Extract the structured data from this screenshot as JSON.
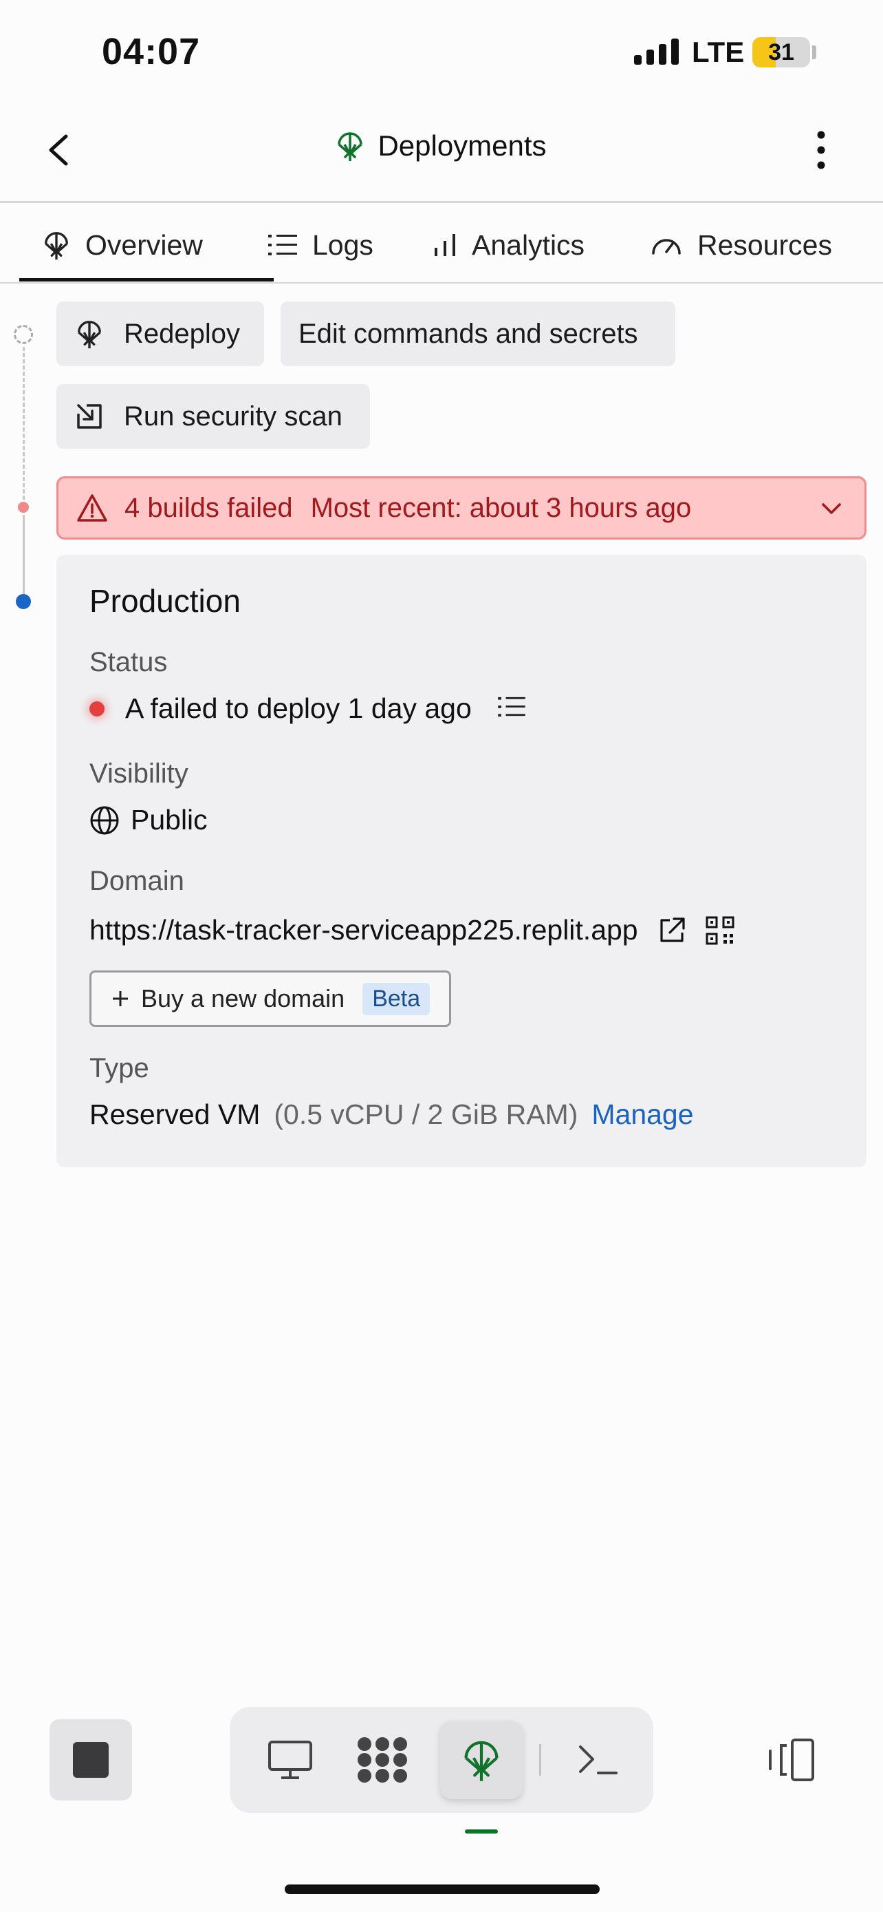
{
  "status_bar": {
    "time": "04:07",
    "network": "LTE",
    "battery": "31",
    "battery_level": 0.31,
    "battery_color": "#f5c518"
  },
  "header": {
    "back_icon": "chevron-left-icon",
    "title_icon": "deployments-icon",
    "title": "Deployments",
    "more_icon": "more-vertical-icon"
  },
  "tabs": [
    {
      "label": "Overview",
      "icon": "deployments-icon",
      "active": true
    },
    {
      "label": "Logs",
      "icon": "list-icon",
      "active": false
    },
    {
      "label": "Analytics",
      "icon": "bar-chart-icon",
      "active": false
    },
    {
      "label": "Resources",
      "icon": "gauge-icon",
      "active": false
    }
  ],
  "actions": {
    "redeploy": "Redeploy",
    "edit": "Edit commands and secrets",
    "scan": "Run security scan"
  },
  "alert": {
    "title": "4 builds failed",
    "subtitle": "Most recent: about 3 hours ago",
    "color": "#a1191d"
  },
  "production": {
    "title": "Production",
    "status_label": "Status",
    "status_value": "A failed to deploy 1 day ago",
    "visibility_label": "Visibility",
    "visibility_value": "Public",
    "domain_label": "Domain",
    "domain_value": "https://task-tracker-serviceapp225.replit.app",
    "buy_domain": "Buy a new domain",
    "beta_badge": "Beta",
    "type_label": "Type",
    "type_value": "Reserved VM",
    "type_spec": "(0.5 vCPU / 2 GiB RAM)",
    "manage": "Manage"
  },
  "bottom_bar": {
    "items": [
      "stop-icon",
      "preview-icon",
      "workspace-icon",
      "deployments-icon",
      "shell-icon",
      "device-toggle-icon"
    ],
    "active": "deployments-icon",
    "accent": "#11722c"
  }
}
